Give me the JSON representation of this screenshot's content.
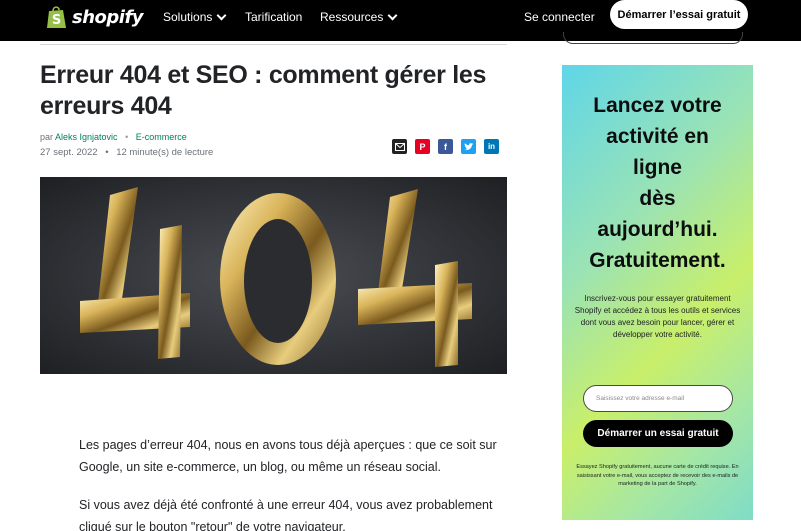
{
  "nav": {
    "logo_text": "shopify",
    "items": [
      {
        "label": "Solutions",
        "has_dropdown": true
      },
      {
        "label": "Tarification",
        "has_dropdown": false
      },
      {
        "label": "Ressources",
        "has_dropdown": true
      }
    ],
    "login_label": "Se connecter",
    "cta_label": "Démarrer l’essai gratuit"
  },
  "article": {
    "title": "Erreur 404 et SEO : comment gérer les erreurs 404",
    "by_prefix": "par",
    "author": "Aleks Ignjatovic",
    "category": "E-commerce",
    "date": "27 sept. 2022",
    "read_time": "12 minute(s) de lecture",
    "share_icons": [
      "email-icon",
      "pinterest-icon",
      "facebook-icon",
      "twitter-icon",
      "linkedin-icon"
    ],
    "hero_text": "404",
    "paragraph_1": "Les pages d’erreur 404, nous en avons tous déjà aperçues : que ce soit sur Google, un site e-commerce, un blog, ou même un réseau social.",
    "paragraph_2": "Si vous avez déjà été confronté à une erreur 404, vous avez probablement cliqué sur le bouton \"retour\" de votre navigateur."
  },
  "promo": {
    "headline_lines": [
      "Lancez votre",
      "activité en",
      "ligne",
      "dès",
      "aujourd’hui.",
      "Gratuitement."
    ],
    "body": "Inscrivez-vous pour essayer gratuitement Shopify et accédez à tous les outils et services dont vous avez besoin pour lancer, gérer et développer votre activité.",
    "email_placeholder": "Saisissez votre adresse e-mail",
    "cta_label": "Démarrer un essai gratuit",
    "fine_print": "Essayez Shopify gratuitement, aucune carte de crédit requise. En saisissant votre e-mail, vous acceptez de recevoir des e-mails de marketing de la part de Shopify."
  },
  "colors": {
    "nav_bg": "#000000",
    "link_green": "#008060",
    "email_share": "#222222",
    "pinterest": "#e60023",
    "facebook": "#3b5998",
    "twitter": "#1da1f2",
    "linkedin": "#0077b5"
  }
}
